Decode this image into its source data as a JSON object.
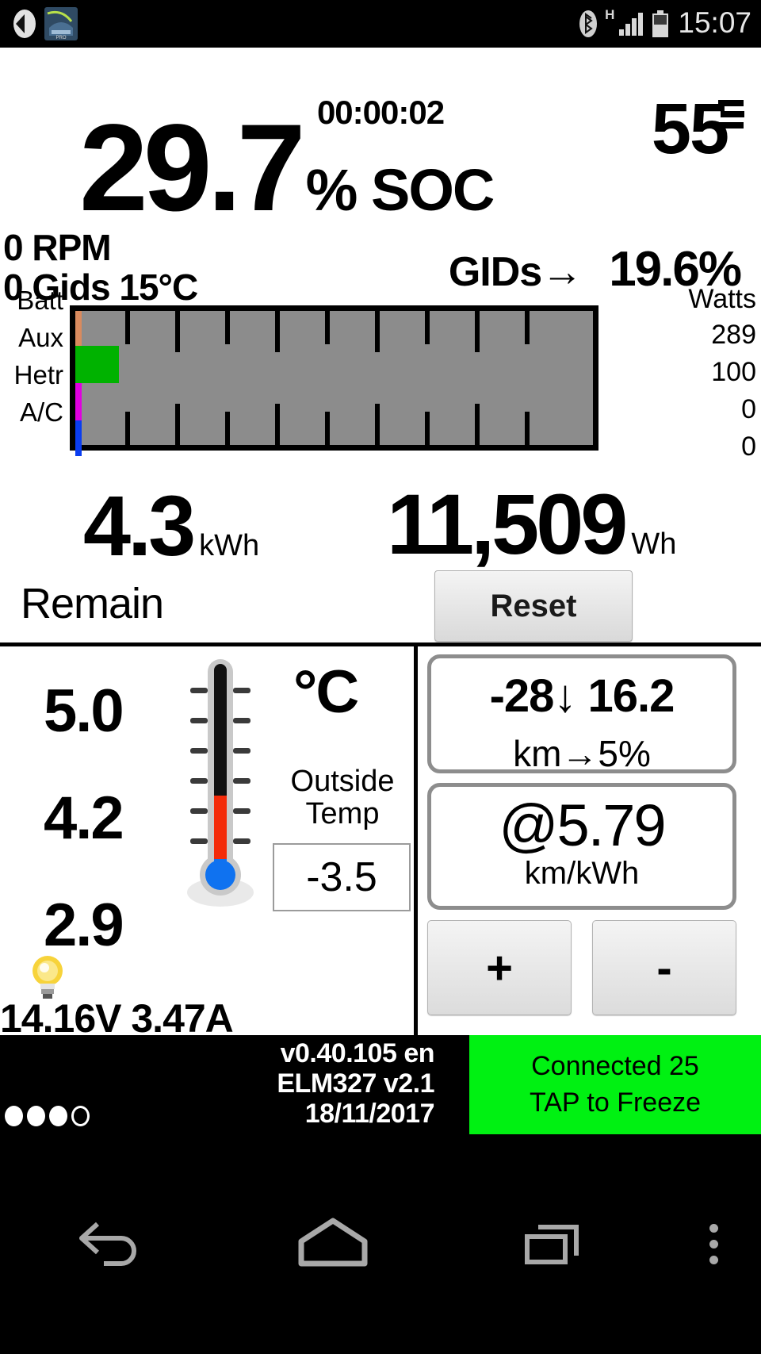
{
  "status_bar": {
    "icons": [
      "navigation-arrow-icon",
      "car-app-icon",
      "bluetooth-icon",
      "signal-h-icon",
      "signal-bars-icon",
      "battery-icon"
    ],
    "network_type": "H",
    "clock": "15:07"
  },
  "header": {
    "timer": "00:00:02",
    "menu_icon": "hamburger-menu-icon",
    "soc_value": "29.7",
    "soc_unit": "% SOC",
    "soc_right": "55"
  },
  "readouts": {
    "rpm": "0 RPM",
    "gids_temp": "0 Gids 15°C",
    "gids_label": "GIDs→",
    "gids_percent": "19.6%"
  },
  "chart_data": {
    "type": "bar",
    "title": "",
    "orientation": "horizontal",
    "categories": [
      "Batt",
      "Aux",
      "Hetr",
      "A/C"
    ],
    "values": [
      289,
      100,
      0,
      0
    ],
    "unit_header": "Watts",
    "value_labels": [
      "289",
      "100",
      "0",
      "0"
    ],
    "bar_colors": [
      "#d98a5e",
      "#00b200",
      "#e000e0",
      "#0a3df0"
    ],
    "bar_fill_percent": [
      1.2,
      8.2,
      1.2,
      1.2
    ],
    "plot_bg": "#8c8c8c",
    "ticks": 9,
    "grid": true
  },
  "energy": {
    "remaining_value": "4.3",
    "remaining_unit": "kWh",
    "remaining_label": "Remain",
    "trip_value": "11,509",
    "trip_unit": "Wh",
    "reset_label": "Reset"
  },
  "temp_panel": {
    "values": [
      "5.0",
      "4.2",
      "2.9"
    ],
    "unit": "°C",
    "outside_label_line1": "Outside",
    "outside_label_line2": "Temp",
    "outside_value": "-3.5",
    "thermometer_icon": "thermometer-icon",
    "bulb_icon": "lightbulb-icon",
    "voltage": "14.16V 3.47A"
  },
  "range_panel": {
    "box1_line1": "-28↓ 16.2",
    "box1_line2": "km→5%",
    "box2_value": "@5.79",
    "box2_unit": "km/kWh",
    "plus_label": "+",
    "minus_label": "-"
  },
  "footer": {
    "dots": [
      "filled",
      "filled",
      "filled",
      "hollow"
    ],
    "version": "v0.40.105 en",
    "adapter": "ELM327 v2.1",
    "date": "18/11/2017",
    "connection_line1": "Connected 25",
    "connection_line2": "TAP to Freeze",
    "connection_color": "#00f112"
  },
  "navbar": {
    "back_icon": "back-arrow-icon",
    "home_icon": "home-icon",
    "recents_icon": "recent-apps-icon",
    "menu_icon": "kebab-menu-icon"
  }
}
